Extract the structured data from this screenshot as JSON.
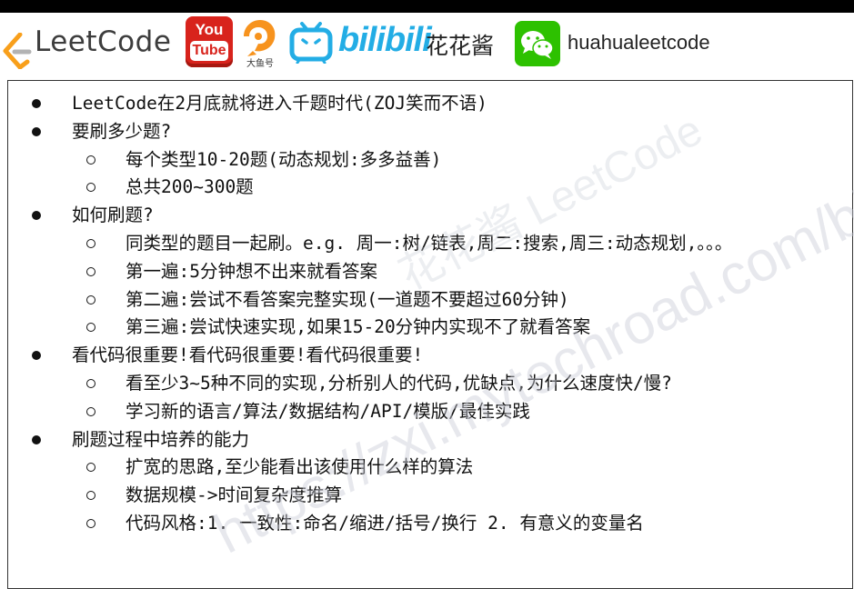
{
  "header": {
    "leetcode_logo_text": "LeetCode",
    "youtube_line1": "You",
    "youtube_line2": "Tube",
    "douyu_label": "大鱼号",
    "bilibili_text": "bilibili",
    "channel_name": "花花酱",
    "wechat_id": "huahualeetcode"
  },
  "watermark": {
    "text": "https://zxi.mytechroad.com/blog",
    "overlay": "花花酱 LeetCode"
  },
  "colors": {
    "leetcode_orange": "#f89f1b",
    "youtube_red": "#d8231c",
    "bilibili_blue": "#23ade5",
    "wechat_green": "#2dc100"
  },
  "outline": {
    "items": [
      {
        "text": "LeetCode在2月底就将进入千题时代(ZOJ笑而不语)",
        "children": []
      },
      {
        "text": "要刷多少题?",
        "children": [
          "每个类型10-20题(动态规划:多多益善)",
          "总共200~300题"
        ]
      },
      {
        "text": "如何刷题?",
        "children": [
          "同类型的题目一起刷。e.g. 周一:树/链表,周二:搜索,周三:动态规划,。。。",
          "第一遍:5分钟想不出来就看答案",
          "第二遍:尝试不看答案完整实现(一道题不要超过60分钟)",
          "第三遍:尝试快速实现,如果15-20分钟内实现不了就看答案"
        ]
      },
      {
        "text": "看代码很重要!看代码很重要!看代码很重要!",
        "children": [
          "看至少3~5种不同的实现,分析别人的代码,优缺点,为什么速度快/慢?",
          "学习新的语言/算法/数据结构/API/模版/最佳实践"
        ]
      },
      {
        "text": "刷题过程中培养的能力",
        "children": [
          "扩宽的思路,至少能看出该使用什么样的算法",
          "数据规模->时间复杂度推算",
          "代码风格:1. 一致性:命名/缩进/括号/换行 2. 有意义的变量名"
        ]
      }
    ]
  }
}
